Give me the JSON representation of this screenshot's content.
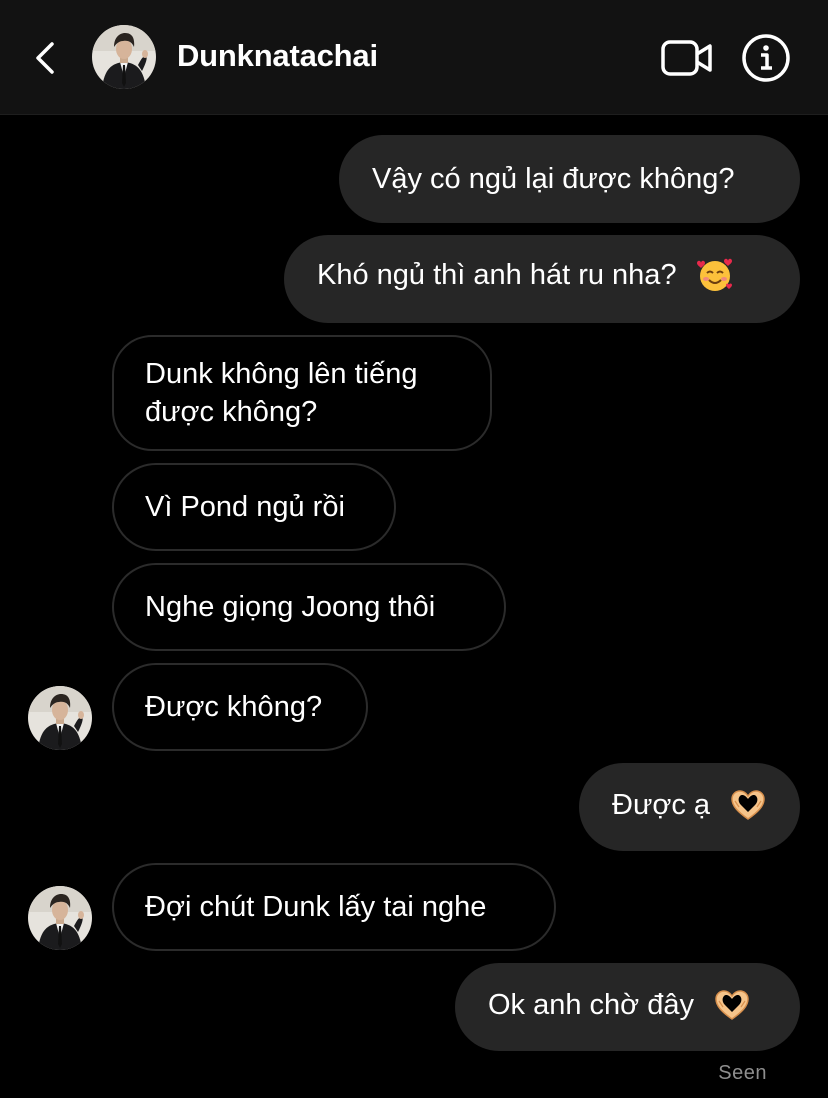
{
  "header": {
    "contact_name": "Dunknatachai"
  },
  "messages": [
    {
      "side": "outgoing",
      "text": "Vậy có ngủ lại được không?"
    },
    {
      "side": "outgoing",
      "text": "Khó ngủ thì anh hát ru nha?",
      "emoji": "smiling-face-with-hearts-icon"
    },
    {
      "side": "incoming",
      "line1": "Dunk không lên tiếng",
      "line2": "được không?"
    },
    {
      "side": "incoming",
      "text": "Vì Pond ngủ rồi"
    },
    {
      "side": "incoming",
      "text": "Nghe giọng Joong thôi"
    },
    {
      "side": "incoming",
      "text": "Được không?",
      "avatar": true
    },
    {
      "side": "outgoing",
      "text": "Được ạ",
      "emoji": "heart-hands-icon"
    },
    {
      "side": "incoming",
      "text": "Đợi chút Dunk lấy tai nghe",
      "avatar": true
    },
    {
      "side": "outgoing",
      "text": "Ok anh chờ đây",
      "emoji": "heart-hands-icon"
    }
  ],
  "status": {
    "seen": "Seen"
  },
  "colors": {
    "header_bg": "#121212",
    "outgoing_bubble": "#262626",
    "incoming_border": "#2b2b2b",
    "seen_text": "#8e8e8e"
  }
}
